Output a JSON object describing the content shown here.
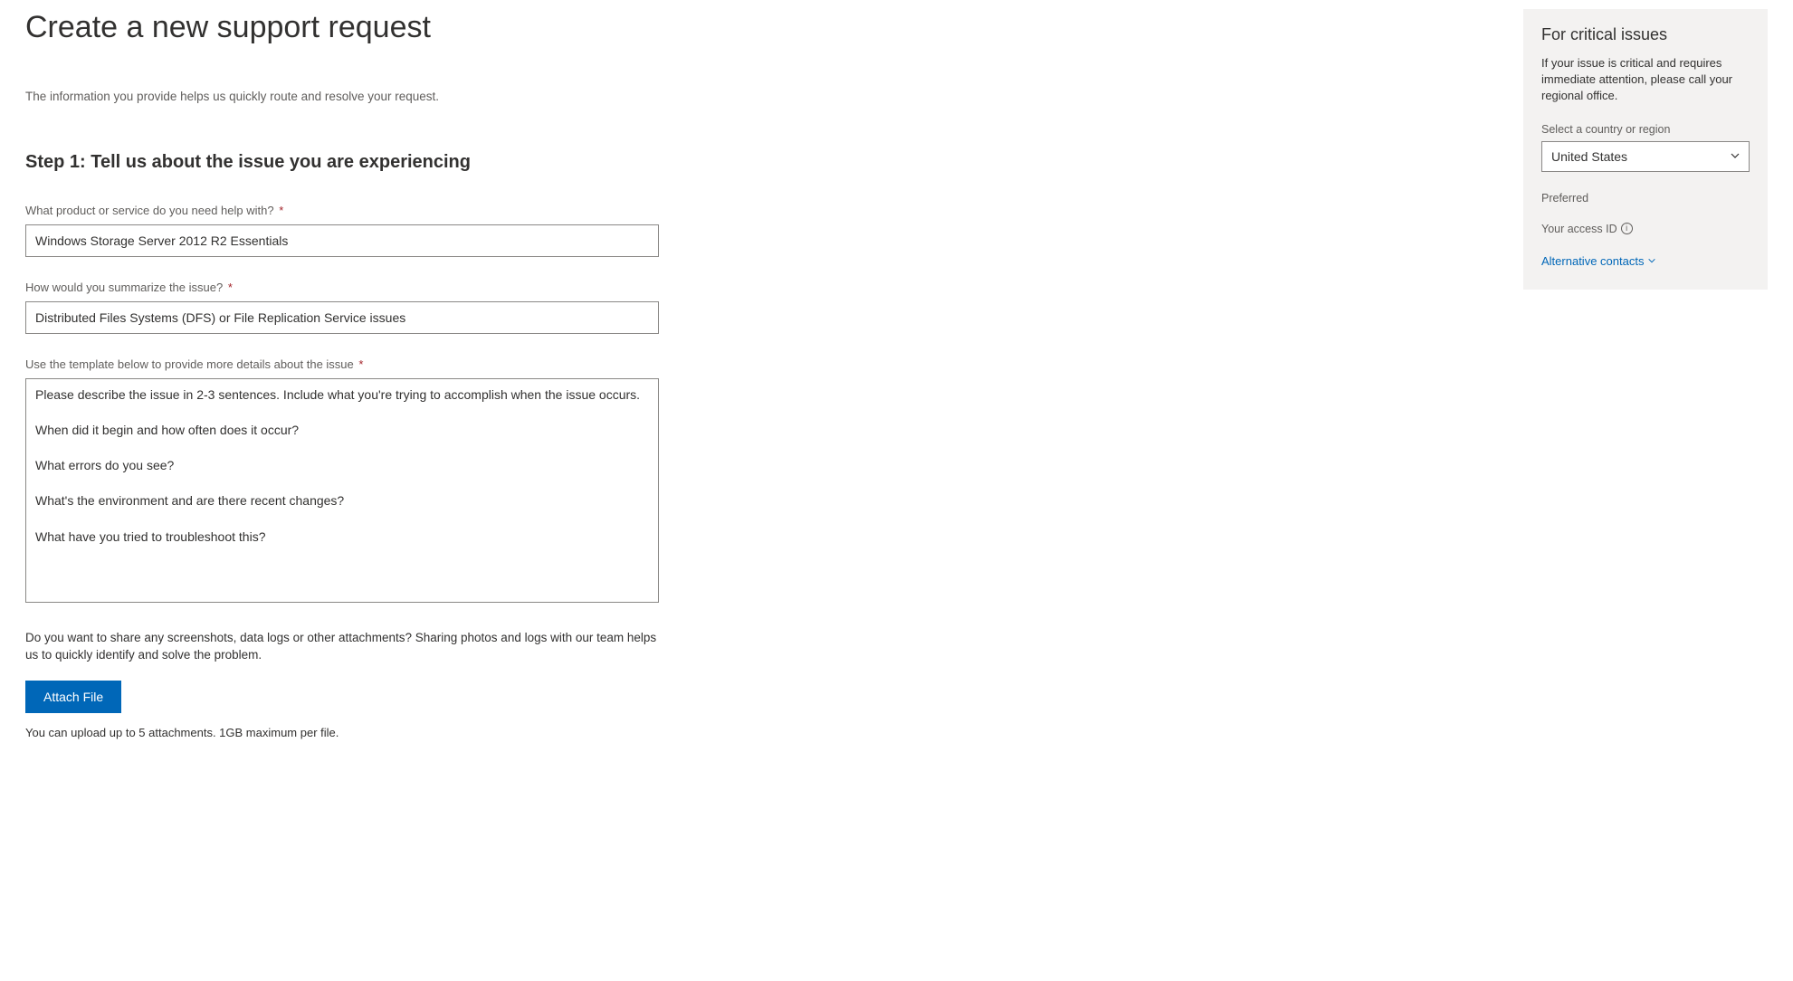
{
  "page": {
    "title": "Create a new support request",
    "intro": "The information you provide helps us quickly route and resolve your request."
  },
  "step1": {
    "heading": "Step 1: Tell us about the issue you are experiencing",
    "product": {
      "label": "What product or service do you need help with?",
      "value": "Windows Storage Server 2012 R2 Essentials"
    },
    "summary": {
      "label": "How would you summarize the issue?",
      "value": "Distributed Files Systems (DFS) or File Replication Service issues"
    },
    "details": {
      "label": "Use the template below to provide more details about the issue",
      "value": "Please describe the issue in 2-3 sentences. Include what you're trying to accomplish when the issue occurs.\n\nWhen did it begin and how often does it occur?\n\nWhat errors do you see?\n\nWhat's the environment and are there recent changes?\n\nWhat have you tried to troubleshoot this?"
    },
    "attach": {
      "desc": "Do you want to share any screenshots, data logs or other attachments? Sharing photos and logs with our team helps us to quickly identify and solve the problem.",
      "button": "Attach File",
      "hint": "You can upload up to 5 attachments. 1GB maximum per file."
    }
  },
  "sidebar": {
    "title": "For critical issues",
    "desc": "If your issue is critical and requires immediate attention, please call your regional office.",
    "region_label": "Select a country or region",
    "region_value": "United States",
    "preferred_label": "Preferred",
    "access_id_label": "Your access ID",
    "alt_contacts": "Alternative contacts"
  },
  "required_marker": "*"
}
